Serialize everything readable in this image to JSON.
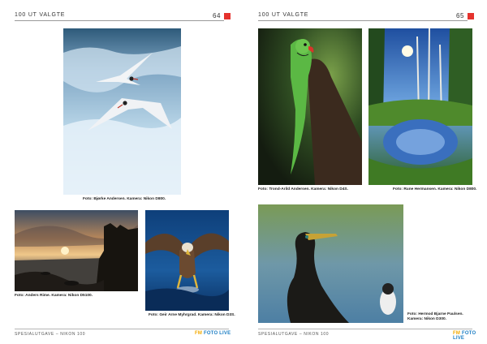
{
  "left_page": {
    "header_title": "100 UT VALGTE",
    "page_number": "64",
    "footer_text": "SPESIALUTGAVE – NIKON 100",
    "captions": {
      "terns": "Foto: Bjørke Andersen. Kamera: Nikon D800.",
      "sunset": "Foto: Anders Rime. Kamera: Nikon D5100.",
      "eagle": "Foto: Geir Arne Myhrgrad. Kamera: Nikon D3S."
    }
  },
  "right_page": {
    "header_title": "100 UT VALGTE",
    "page_number": "65",
    "footer_text": "SPESIALUTGAVE – NIKON 100",
    "captions": {
      "parakeet": "Foto: Trond-Arild Andersen. Kamera: Nikon D4S.",
      "forest": "Foto: Rune Hermansen. Kamera: Nikon D800.",
      "cormorant_line1": "Foto: Hermod Bjarne Paulsen.",
      "cormorant_line2": "Kamera: Nikon D300."
    }
  },
  "footer_logo": {
    "part1": "FM",
    "part2": "FOTO LIVE"
  },
  "colors": {
    "marker": "#e5322d",
    "logo_yellow": "#f2a900",
    "logo_blue": "#1e7fc4"
  }
}
